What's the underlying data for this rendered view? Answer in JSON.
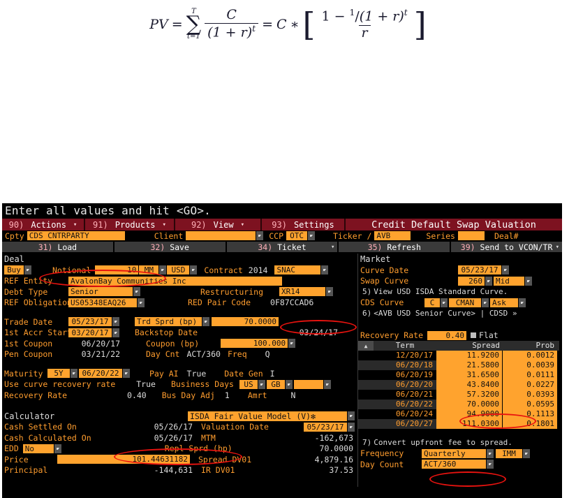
{
  "formula": {
    "lhs": "PV",
    "eq1": "=",
    "sum_upper": "T",
    "sum_lower": "t=1",
    "frac1_num": "C",
    "frac1_den": "(1 + r)",
    "frac1_den_exp": "t",
    "eq2": "=",
    "c": "C",
    "times": "∗",
    "bracket_num_a": "1 − ",
    "bracket_num_b": "1",
    "bracket_num_slash": "/",
    "bracket_num_c": "(1 + r)",
    "bracket_num_exp": "t",
    "bracket_den": "r"
  },
  "terminal": {
    "prompt": "Enter all values and hit <GO>.",
    "menu": [
      {
        "num": "90)",
        "label": "Actions",
        "caret": "▾"
      },
      {
        "num": "91)",
        "label": "Products",
        "caret": "▾"
      },
      {
        "num": "92)",
        "label": "View",
        "caret": "▾"
      },
      {
        "num": "93)",
        "label": "Settings",
        "caret": ""
      }
    ],
    "title": "Credit Default Swap Valuation",
    "toolbar": {
      "cpty_label": "Cpty",
      "cpty_value": "CDS CNTRPARTY",
      "client_label": "Client",
      "client_value": "",
      "ccp_label": "CCP",
      "ccp_value": "OTC",
      "ticker_label": "Ticker /",
      "ticker_value": "AVB",
      "series_label": "Series",
      "series_value": "",
      "deal_label": "Deal#"
    },
    "fnbar": [
      {
        "num": "31)",
        "label": "Load",
        "caret": ""
      },
      {
        "num": "32)",
        "label": "Save",
        "caret": ""
      },
      {
        "num": "34)",
        "label": "Ticket",
        "caret": "▾"
      },
      {
        "num": "35)",
        "label": "Refresh",
        "caret": ""
      },
      {
        "num": "39)",
        "label": "Send to VCON/TR",
        "caret": "▾"
      }
    ],
    "deal": {
      "header": "Deal",
      "side": "Buy",
      "notional_label": "Notional",
      "notional_value": "10",
      "notional_unit": "MM",
      "notional_ccy": "USD",
      "contract_label": "Contract",
      "contract_year": "2014",
      "contract_value": "SNAC",
      "ref_entity_label": "REF Entity",
      "ref_entity_value": "AvalonBay Communities Inc",
      "debt_type_label": "Debt Type",
      "debt_type_value": "Senior",
      "restructuring_label": "Restructuring",
      "restructuring_value": "XR14",
      "ref_obligation_label": "REF Obligation",
      "ref_obligation_value": "US05348EAQ26",
      "red_pair_label": "RED Pair Code",
      "red_pair_value": "0F87CCAD6",
      "trade_date_label": "Trade Date",
      "trade_date_value": "05/23/17",
      "trd_sprd_label": "Trd Sprd (bp)",
      "trd_sprd_value": "70.0000",
      "accr_start_label": "1st Accr Start",
      "accr_start_value": "03/20/17",
      "backstop_label": "Backstop Date",
      "backstop_value": "03/24/17",
      "first_coupon_label": "1st Coupon",
      "first_coupon_value": "06/20/17",
      "coupon_label": "Coupon (bp)",
      "coupon_value": "100.000",
      "pen_coupon_label": "Pen Coupon",
      "pen_coupon_value": "03/21/22",
      "day_cnt_label": "Day Cnt",
      "day_cnt_value": "ACT/360",
      "freq_label": "Freq",
      "freq_value": "Q",
      "maturity_label": "Maturity",
      "maturity_tenor": "5Y",
      "maturity_date": "06/20/22",
      "pay_ai_label": "Pay AI",
      "pay_ai_value": "True",
      "date_gen_label": "Date Gen",
      "date_gen_value": "I",
      "use_curve_rr_label": "Use curve recovery rate",
      "use_curve_rr_value": "True",
      "business_days_label": "Business Days",
      "business_days_1": "US",
      "business_days_2": "GB",
      "business_days_3": "",
      "recovery_rate_label": "Recovery Rate",
      "recovery_rate_value": "0.40",
      "bus_day_adj_label": "Bus Day Adj",
      "bus_day_adj_value": "1",
      "amrt_label": "Amrt",
      "amrt_value": "N"
    },
    "calculator": {
      "header": "Calculator",
      "model": "ISDA Fair Value Model (V)✻",
      "cash_settled_label": "Cash Settled On",
      "cash_settled_value": "05/26/17",
      "valuation_date_label": "Valuation Date",
      "valuation_date_value": "05/23/17",
      "cash_calculated_label": "Cash Calculated On",
      "cash_calculated_value": "05/26/17",
      "mtm_label": "MTM",
      "mtm_value": "-162,673",
      "edd_label": "EDD",
      "edd_value": "No",
      "repl_sprd_label": "Repl Sprd (bp)",
      "repl_sprd_value": "70.0000",
      "price_label": "Price",
      "price_value": "101.44631182",
      "spread_dv01_label": "Spread DV01",
      "spread_dv01_value": "4,879.16",
      "principal_label": "Principal",
      "principal_value": "-144,631",
      "ir_dv01_label": "IR DV01",
      "ir_dv01_value": "37.53"
    },
    "market": {
      "header": "Market",
      "curve_date_label": "Curve Date",
      "curve_date_value": "05/23/17",
      "swap_curve_label": "Swap Curve",
      "swap_curve_value": "260",
      "swap_curve_side": "Mid",
      "view_curve_num": "5)",
      "view_curve_text": "View USD ISDA Standard Curve.",
      "cds_curve_label": "CDS Curve",
      "cds_curve_src": "C",
      "cds_curve_provider": "CMAN",
      "cds_curve_side": "Ask",
      "avb_curve_num": "6)",
      "avb_curve_text": "<AVB USD Senior Curve> | CDSD »",
      "recovery_rate_label": "Recovery Rate",
      "recovery_rate_value": "0.40",
      "flat_label": "Flat",
      "convert_num": "7)",
      "convert_text": "Convert upfront fee to spread.",
      "frequency_label": "Frequency",
      "frequency_value": "Quarterly",
      "imm_value": "IMM",
      "day_count_label": "Day Count",
      "day_count_value": "ACT/360"
    },
    "curve_table": {
      "columns": [
        "Term",
        "Spread",
        "Prob"
      ],
      "rows": [
        {
          "term": "12/20/17",
          "spread": "11.9200",
          "prob": "0.0012"
        },
        {
          "term": "06/20/18",
          "spread": "21.5800",
          "prob": "0.0039"
        },
        {
          "term": "06/20/19",
          "spread": "31.6500",
          "prob": "0.0111"
        },
        {
          "term": "06/20/20",
          "spread": "43.8400",
          "prob": "0.0227"
        },
        {
          "term": "06/20/21",
          "spread": "57.3200",
          "prob": "0.0393"
        },
        {
          "term": "06/20/22",
          "spread": "70.0000",
          "prob": "0.0595"
        },
        {
          "term": "06/20/24",
          "spread": "94.9000",
          "prob": "0.1113"
        },
        {
          "term": "06/20/27",
          "spread": "111.0300",
          "prob": "0.1801"
        }
      ]
    },
    "colors": {
      "background": "#000000",
      "accent_orange": "#ff9d2e",
      "field_orange": "#ffa32e",
      "menu_red": "#7d1220",
      "annotation_red": "#e8130f",
      "value_gray": "#dcdcdc"
    }
  }
}
